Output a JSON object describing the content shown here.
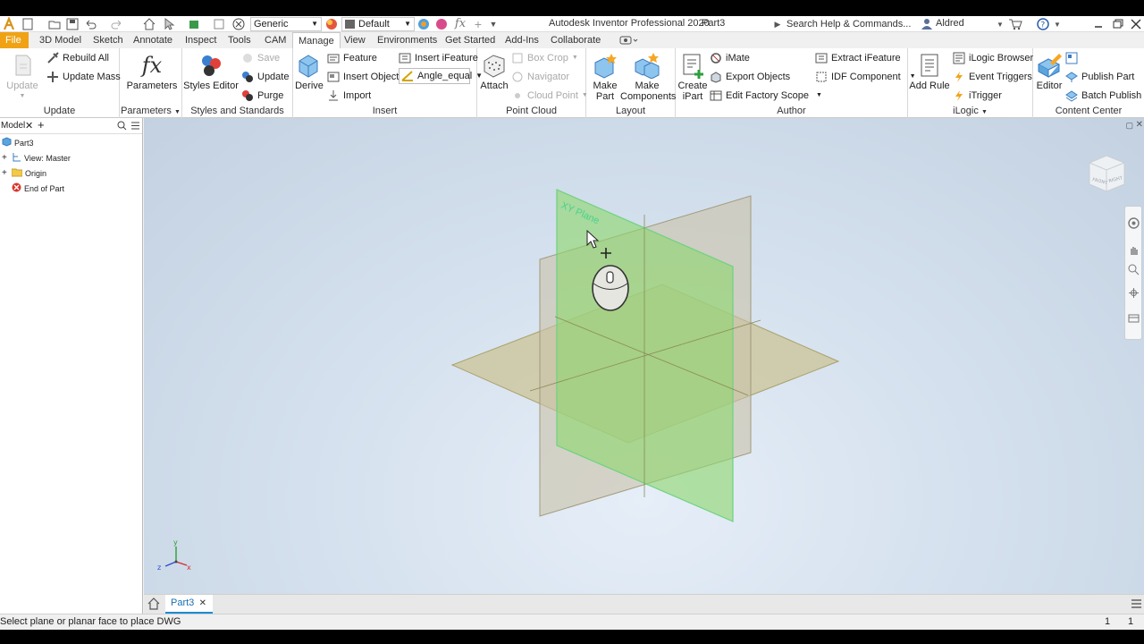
{
  "app_title": "Autodesk Inventor Professional 2020",
  "doc_title": "Part3",
  "search_placeholder": "Search Help & Commands...",
  "user": "Aldred",
  "qat": {
    "material": "Generic",
    "appearance": "Default"
  },
  "tabs": [
    "File",
    "3D Model",
    "Sketch",
    "Annotate",
    "Inspect",
    "Tools",
    "CAM",
    "Manage",
    "View",
    "Environments",
    "Get Started",
    "Add-Ins",
    "Collaborate"
  ],
  "ribbon": {
    "update": {
      "title": "Update",
      "update": "Update",
      "rebuild_all": "Rebuild All",
      "update_mass": "Update Mass"
    },
    "parameters": {
      "title": "Parameters",
      "parameters": "Parameters"
    },
    "styles": {
      "title": "Styles and Standards",
      "styles_editor": "Styles Editor",
      "save": "Save",
      "update": "Update",
      "purge": "Purge"
    },
    "insert": {
      "title": "Insert",
      "derive": "Derive",
      "feature": "Feature",
      "insert_object": "Insert Object",
      "import": "Import",
      "insert_ifeature": "Insert iFeature",
      "angle_dropdown": "Angle_equal"
    },
    "point_cloud": {
      "title": "Point Cloud",
      "attach": "Attach",
      "box_crop": "Box Crop",
      "navigator": "Navigator",
      "cloud_point": "Cloud Point"
    },
    "layout": {
      "title": "Layout",
      "make_part": "Make Part",
      "make_components": "Make Components"
    },
    "author": {
      "title": "Author",
      "create_ipart": "Create iPart",
      "imate": "iMate",
      "export_objects": "Export Objects",
      "edit_factory_scope": "Edit Factory Scope",
      "extract_ifeature": "Extract iFeature",
      "idf_component": "IDF Component"
    },
    "ilogic": {
      "title": "iLogic",
      "add_rule": "Add Rule",
      "ilogic_browser": "iLogic Browser",
      "event_triggers": "Event Triggers",
      "itrigger": "iTrigger"
    },
    "content_center": {
      "title": "Content Center",
      "editor": "Editor",
      "publish_part": "Publish Part",
      "batch_publish": "Batch Publish"
    }
  },
  "browser": {
    "tab": "Model",
    "items": [
      "Part3",
      "View: Master",
      "Origin",
      "End of Part"
    ]
  },
  "viewport": {
    "plane_label": "XY Plane",
    "viewcube_front": "FRONT",
    "viewcube_right": "RIGHT"
  },
  "doc_tab": "Part3",
  "status": {
    "message": "Select plane or planar face to place DWG",
    "count1": "1",
    "count2": "1"
  }
}
